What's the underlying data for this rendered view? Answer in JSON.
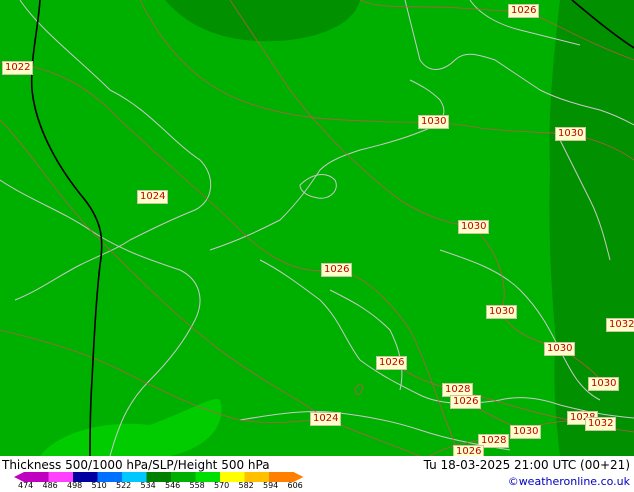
{
  "title": "Thickness 500/1000 hPa/SLP/Height 500 hPa",
  "datetime": "Tu 18-03-2025 21:00 UTC (00+21)",
  "credit": "©weatheronline.co.uk",
  "colors": {
    "base": "#00b000",
    "dark": "#009000",
    "light": "#00d000",
    "coast": "#c8c8c8",
    "isobar": "#d05050"
  },
  "legend": {
    "ticks": [
      "474",
      "486",
      "498",
      "510",
      "522",
      "534",
      "546",
      "558",
      "570",
      "582",
      "594",
      "606"
    ],
    "colors": [
      "#c000c0",
      "#ff40ff",
      "#0000a0",
      "#0070ff",
      "#00c8ff",
      "#008000",
      "#00b000",
      "#00e000",
      "#ffff00",
      "#ffc000",
      "#ff8000"
    ]
  },
  "isobar_labels": [
    "1026",
    "1022",
    "1030",
    "1030",
    "1024",
    "1030",
    "1026",
    "1030",
    "1032",
    "1030",
    "1026",
    "1030",
    "1028",
    "1026",
    "1024",
    "1028",
    "1030",
    "1032",
    "1028",
    "1026"
  ]
}
